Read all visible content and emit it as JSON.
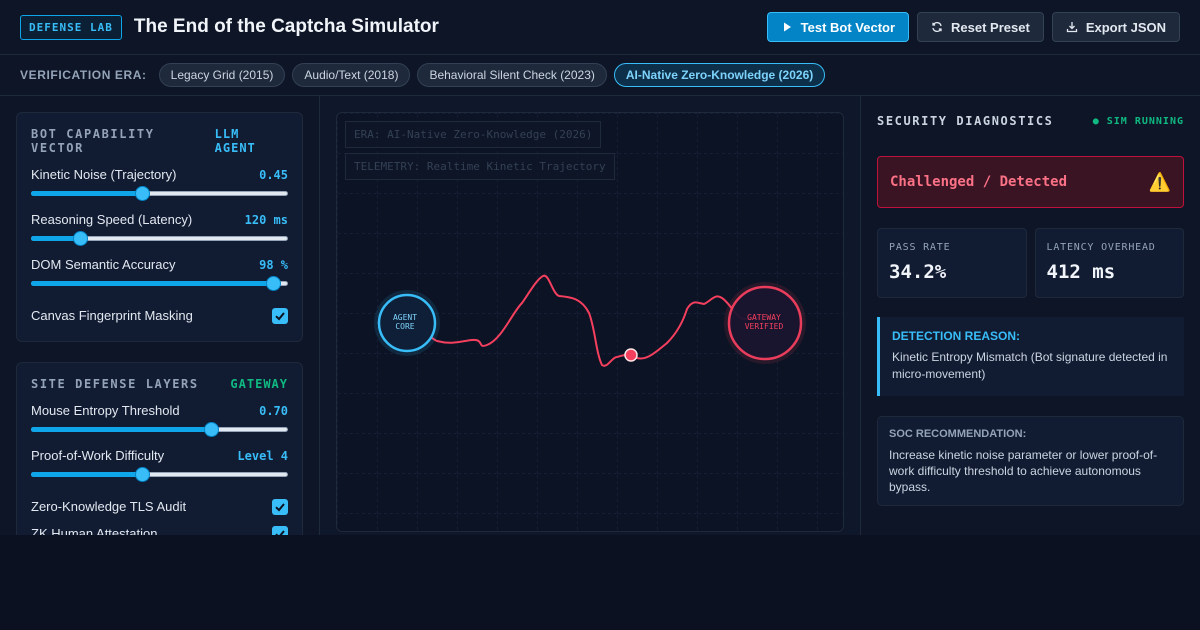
{
  "header": {
    "badge": "DEFENSE LAB",
    "title": "The End of the Captcha Simulator",
    "actions": {
      "test": "Test Bot Vector",
      "reset": "Reset Preset",
      "export": "Export JSON"
    }
  },
  "era": {
    "label": "VERIFICATION ERA:",
    "options": [
      "Legacy Grid (2015)",
      "Audio/Text (2018)",
      "Behavioral Silent Check (2023)",
      "AI-Native Zero-Knowledge (2026)"
    ],
    "selected": "AI-Native Zero-Knowledge (2026)"
  },
  "bot_panel": {
    "title": "BOT CAPABILITY VECTOR",
    "tag": "LLM AGENT",
    "tag_color": "#38bdf8",
    "sliders": [
      {
        "label": "Kinetic Noise (Trajectory)",
        "value_text": "0.45",
        "level": 0.43
      },
      {
        "label": "Reasoning Speed (Latency)",
        "value_text": "120 ms",
        "level": 0.19
      },
      {
        "label": "DOM Semantic Accuracy",
        "value_text": "98 %",
        "level": 0.94
      }
    ],
    "checks": [
      {
        "label": "Canvas Fingerprint Masking",
        "checked": true
      }
    ]
  },
  "defense_panel": {
    "title": "SITE DEFENSE LAYERS",
    "tag": "GATEWAY",
    "tag_color": "#10b981",
    "sliders": [
      {
        "label": "Mouse Entropy Threshold",
        "value_text": "0.70",
        "level": 0.7
      },
      {
        "label": "Proof-of-Work Difficulty",
        "value_text": "Level 4",
        "level": 0.43
      }
    ],
    "checks": [
      {
        "label": "Zero-Knowledge TLS Audit",
        "checked": true
      },
      {
        "label": "ZK Human Attestation",
        "checked": true
      }
    ]
  },
  "sim": {
    "era_overlay": "ERA: AI-Native Zero-Knowledge (2026)",
    "telemetry_overlay": "TELEMETRY: Realtime Kinetic Trajectory",
    "agent_node": [
      "AGENT",
      "CORE"
    ],
    "gateway_node": [
      "GATEWAY",
      "VERIFIED"
    ],
    "colors": {
      "agent": "#38bdf8",
      "gateway": "#f43f5e",
      "trajectory": "#f43f5e"
    }
  },
  "diagnostics": {
    "title": "SECURITY DIAGNOSTICS",
    "sim_status": "● SIM RUNNING",
    "status": "Challenged / Detected",
    "status_icon": "⚠️",
    "metrics": [
      {
        "label": "PASS RATE",
        "value": "34.2%"
      },
      {
        "label": "LATENCY OVERHEAD",
        "value": "412 ms"
      }
    ],
    "reason_title": "DETECTION REASON:",
    "reason_text": "Kinetic Entropy Mismatch (Bot signature detected in micro-movement)",
    "soc_title": "SOC RECOMMENDATION:",
    "soc_text": "Increase kinetic noise parameter or lower proof-of-work difficulty threshold to achieve autonomous bypass."
  }
}
